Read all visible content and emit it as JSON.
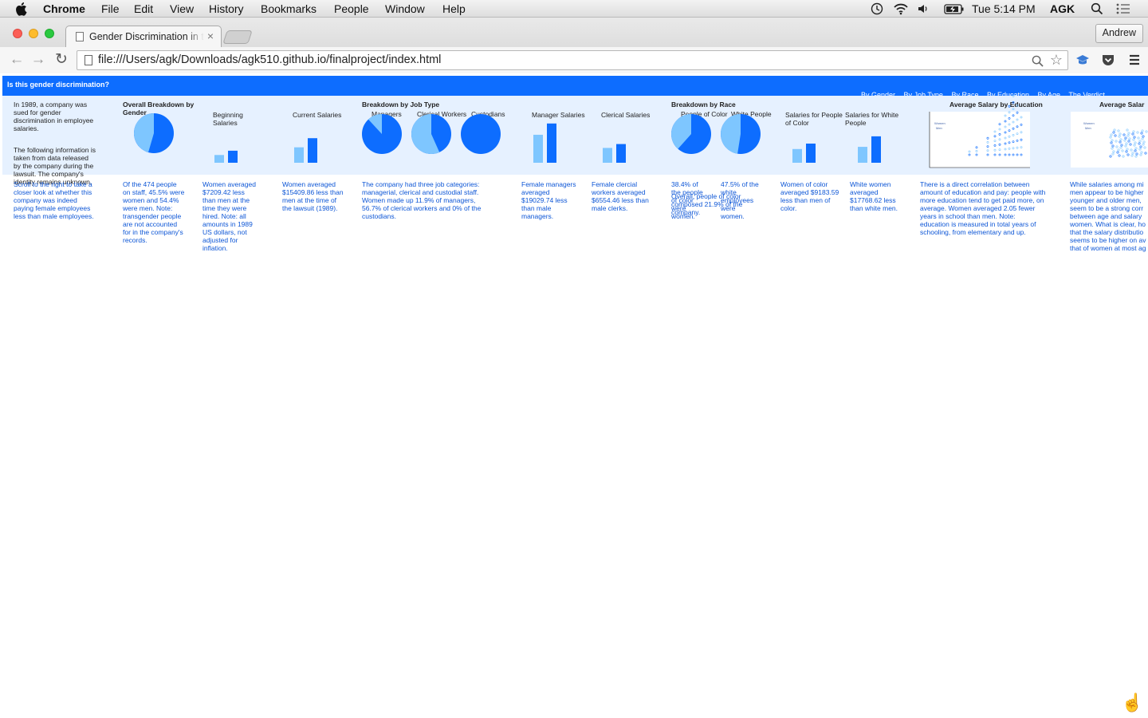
{
  "menubar": {
    "app": "Chrome",
    "items": [
      "File",
      "Edit",
      "View",
      "History",
      "Bookmarks",
      "People",
      "Window",
      "Help"
    ],
    "clock": "Tue 5:14 PM",
    "user": "AGK"
  },
  "browser": {
    "tab_title": "Gender Discrimination in the",
    "profile": "Andrew",
    "url": "file:///Users/agk/Downloads/agk510.github.io/finalproject/index.html"
  },
  "site": {
    "title": "Is this gender discrimination?",
    "nav": [
      "By Gender",
      "By Job Type",
      "By Race",
      "By Education",
      "By Age",
      "The Verdict"
    ]
  },
  "intro": {
    "p1": "In 1989, a company was sued for gender discrimination in employee salaries.",
    "p2": "The following information is taken from data released by the company during the lawsuit. The company's identity remains unknown.",
    "p3": "Scroll to the right to take a closer look at whether this company was indeed paying female employees less than male employees."
  },
  "sections": {
    "gender": "Overall Breakdown by Gender",
    "job": "Breakdown by Job Type",
    "race": "Breakdown by Race"
  },
  "chart_labels": {
    "beginning": "Beginning Salaries",
    "current": "Current Salaries",
    "managers": "Managers",
    "clerical_workers": "Clerical Workers",
    "custodians": "Custodians",
    "manager_salaries": "Manager Salaries",
    "clerical_salaries": "Clerical Salaries",
    "poc": "People of Color",
    "white": "White People",
    "poc_salaries": "Salaries for People of Color",
    "white_salaries": "Salaries for White People",
    "avg_edu": "Average Salary by Education",
    "avg_age": "Average Salar"
  },
  "captions": {
    "gender": "Of the 474 people on staff, 45.5% were women and 54.4% were men. Note: transgender people are not accounted for in the company's records.",
    "beginning": "Women averaged $7209.42 less than men at the time they were hired. Note: all amounts in 1989 US dollars, not adjusted for inflation.",
    "current": "Women averaged $15409.86 less than men at the time of the lawsuit (1989).",
    "job": "The company had three job categories: managerial, clerical and custodial staff. Women made up 11.9% of managers, 56.7% of clerical workers and 0% of the custodians.",
    "manager": "Female managers averaged $19029.74 less than male managers.",
    "clerical": "Female clercial workers averaged $6554.46 less than male clerks.",
    "poc": "38.4% of the people of color were women.",
    "poc_overlap": "Overall, people of color composed 21.9% of the company.",
    "white": "47.5% of the white employees were women.",
    "poc_salary": "Women of color averaged $9183.59 less than men of color.",
    "white_salary": "White women averaged $17768.62 less than white men.",
    "education": "There is a direct correlation between amount of education and pay: people with more education tend to get paid more, on average. Women averaged 2.05 fewer years in school than men. Note: education is measured in total years of schooling, from elementary and up.",
    "age": "While salaries among mi men appear to be higher younger and older men, seem to be a strong corr between age and salary women. What is clear, ho that the salary distributio seems to be higher on av that of women at most ag"
  },
  "tiny_labels": {
    "women": "Women",
    "men": "Men"
  },
  "colors": {
    "men": "#0d6dff",
    "women": "#7ec6ff",
    "bar": "#0d6dff",
    "band": "#e6f1ff",
    "caption": "#0d56d6"
  },
  "chart_data": [
    {
      "type": "pie",
      "id": "gender",
      "women_pct": 45.5,
      "men_pct": 54.4
    },
    {
      "type": "bar",
      "id": "beginning",
      "series": [
        {
          "name": "Women",
          "values": [
            13092
          ]
        },
        {
          "name": "Men",
          "values": [
            20301
          ]
        }
      ]
    },
    {
      "type": "bar",
      "id": "current",
      "series": [
        {
          "name": "Women",
          "values": [
            26031
          ]
        },
        {
          "name": "Men",
          "values": [
            41441
          ]
        }
      ]
    },
    {
      "type": "pie",
      "id": "managers",
      "women_pct": 11.9,
      "men_pct": 88.1
    },
    {
      "type": "pie",
      "id": "clerical",
      "women_pct": 56.7,
      "men_pct": 43.3
    },
    {
      "type": "pie",
      "id": "custodians",
      "women_pct": 0,
      "men_pct": 100
    },
    {
      "type": "bar",
      "id": "manager_salaries",
      "series": [
        {
          "name": "Women",
          "values": [
            47213
          ]
        },
        {
          "name": "Men",
          "values": [
            66243
          ]
        }
      ]
    },
    {
      "type": "bar",
      "id": "clerical_salaries",
      "series": [
        {
          "name": "Women",
          "values": [
            25004
          ]
        },
        {
          "name": "Men",
          "values": [
            31559
          ]
        }
      ]
    },
    {
      "type": "pie",
      "id": "poc",
      "women_pct": 38.4,
      "men_pct": 61.6
    },
    {
      "type": "pie",
      "id": "white",
      "women_pct": 47.5,
      "men_pct": 52.5
    },
    {
      "type": "bar",
      "id": "poc_salaries",
      "series": [
        {
          "name": "Women",
          "values": [
            23150
          ]
        },
        {
          "name": "Men",
          "values": [
            32334
          ]
        }
      ]
    },
    {
      "type": "bar",
      "id": "white_salaries",
      "series": [
        {
          "name": "Women",
          "values": [
            26819
          ]
        },
        {
          "name": "Men",
          "values": [
            44588
          ]
        }
      ]
    }
  ]
}
